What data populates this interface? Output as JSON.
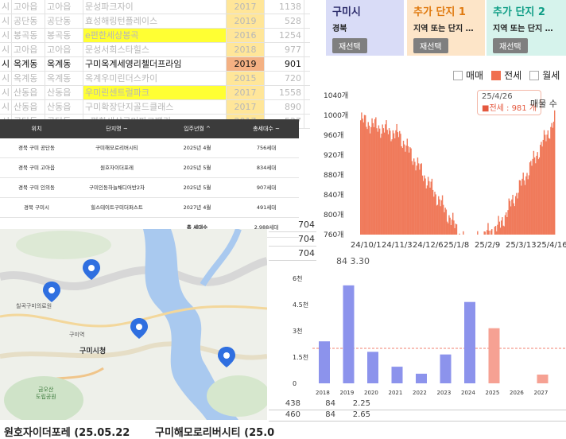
{
  "sheet": {
    "rows": [
      {
        "c0": "시",
        "c1": "고아읍",
        "c2": "고아읍",
        "c3": "문성파크자이",
        "year": "2017",
        "val": "1138",
        "style": "faded",
        "hl": false
      },
      {
        "c0": "시",
        "c1": "공단동",
        "c2": "공단동",
        "c3": "효성해링턴플레이스",
        "year": "2019",
        "val": "528",
        "style": "faded",
        "hl": false
      },
      {
        "c0": "시",
        "c1": "봉곡동",
        "c2": "봉곡동",
        "c3": "e편한세상봉곡",
        "year": "2016",
        "val": "1254",
        "style": "faded",
        "hl": true
      },
      {
        "c0": "시",
        "c1": "고아읍",
        "c2": "고아읍",
        "c3": "문성서희스타힐스",
        "year": "2018",
        "val": "977",
        "style": "faded",
        "hl": false
      },
      {
        "c0": "시",
        "c1": "옥계동",
        "c2": "옥계동",
        "c3": "구미옥계세영리첼더프라임",
        "year": "2019",
        "val": "901",
        "style": "bold",
        "hl": false
      },
      {
        "c0": "시",
        "c1": "옥계동",
        "c2": "옥계동",
        "c3": "옥계우미린더스카이",
        "year": "2015",
        "val": "720",
        "style": "faded",
        "hl": false
      },
      {
        "c0": "시",
        "c1": "산동읍",
        "c2": "산동읍",
        "c3": "우미린센트럴파크",
        "year": "2017",
        "val": "1558",
        "style": "faded",
        "hl": true
      },
      {
        "c0": "시",
        "c1": "산동읍",
        "c2": "산동읍",
        "c3": "구미확장단지골드클래스",
        "year": "2017",
        "val": "890",
        "style": "faded",
        "hl": false
      },
      {
        "c0": "시",
        "c1": "공단동",
        "c2": "공단동",
        "c3": "e편한세상구미파크밸리",
        "year": "2017",
        "val": "527",
        "style": "faded",
        "hl": false
      }
    ],
    "right_col": [
      "704",
      "704",
      "704",
      "",
      "",
      "",
      "",
      "",
      "",
      "",
      "",
      "",
      "438",
      "460"
    ]
  },
  "table": {
    "headers": [
      "위치",
      "단지명 ~",
      "입주년월 ^",
      "총세대수 ~"
    ],
    "rows": [
      [
        "경북 구미 공단동",
        "구미해모로리버시티",
        "2025년 4월",
        "756세대"
      ],
      [
        "경북 구미 고아읍",
        "원호자이더포레",
        "2025년 5월",
        "834세대"
      ],
      [
        "경북 구미 인의동",
        "구미인동하늘채디어반2차",
        "2025년 5월",
        "907세대"
      ],
      [
        "경북 구미시",
        "힐스테이트구미더퍼스트",
        "2027년 4월",
        "491세대"
      ]
    ],
    "total_label": "총 세대수",
    "total_value": "2,988세대"
  },
  "map": {
    "labels": [
      "칠곡구미의료원",
      "구미역",
      "구미시청",
      "금오산",
      "도립공원"
    ]
  },
  "cards": [
    {
      "title": "구미시",
      "sub": "경북",
      "btn": "재선택",
      "bg": "#d9dcf7",
      "title_color": "#2b2b6b"
    },
    {
      "title": "추가 단지 1",
      "sub": "지역 또는 단지 …",
      "btn": "재선택",
      "bg": "#fde5c8",
      "title_color": "#e07a10"
    },
    {
      "title": "추가 단지 2",
      "sub": "지역 또는 단지 …",
      "btn": "재선택",
      "bg": "#d6f3ec",
      "title_color": "#0f9e86"
    }
  ],
  "line_chart": {
    "legend": [
      "매매",
      "전세",
      "월세"
    ],
    "tooltip_date": "25/4/26",
    "tooltip_value": "■전세 : 981 개",
    "tooltip_extra": "매물 수",
    "y_ticks": [
      "1040개",
      "1000개",
      "960개",
      "920개",
      "880개",
      "840개",
      "800개",
      "760개"
    ],
    "x_ticks": [
      "24/10/1",
      "24/11/3",
      "24/12/6",
      "25/1/8",
      "25/2/9",
      "25/3/13",
      "25/4/16"
    ],
    "below_text": "84   3.30"
  },
  "chart_data": {
    "type": "bar",
    "categories": [
      "2018",
      "2019",
      "2020",
      "2021",
      "2022",
      "2023",
      "2024",
      "2025",
      "2026",
      "2027"
    ],
    "values": [
      2400,
      5600,
      1800,
      950,
      550,
      1650,
      4650,
      3150,
      0,
      500
    ],
    "y_ticks": [
      "6천",
      "4.5천",
      "3천",
      "1.5천",
      "0"
    ],
    "ylim": [
      0,
      6000
    ],
    "reference_line": 2000,
    "colors": [
      "#8c93ec",
      "#8c93ec",
      "#8c93ec",
      "#8c93ec",
      "#8c93ec",
      "#8c93ec",
      "#8c93ec",
      "#f6a193",
      "#8c93ec",
      "#f6a193"
    ]
  },
  "bottom_table": {
    "rows": [
      [
        "438",
        "84",
        "2.25"
      ],
      [
        "460",
        "84",
        "2.65"
      ]
    ]
  },
  "footer": {
    "left": "원호자이더포레 (25.05.22",
    "right": "구미해모로리버시티 (25.0"
  }
}
